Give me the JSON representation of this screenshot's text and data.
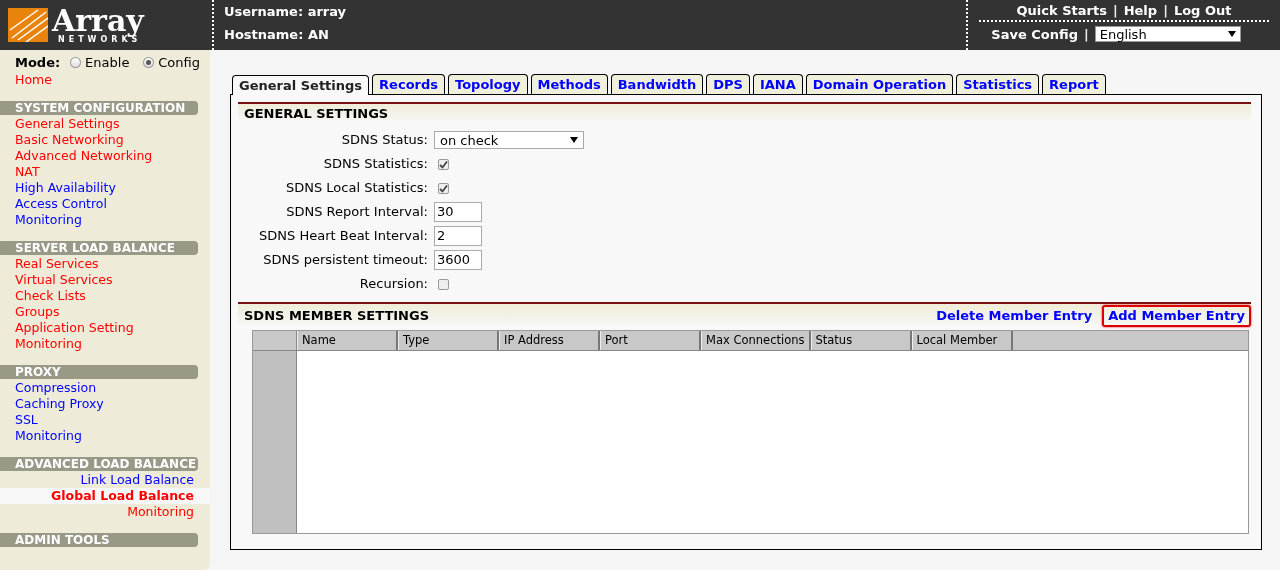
{
  "header": {
    "logo": {
      "word": "Array",
      "sub": "NETWORKS"
    },
    "username": "Username: array",
    "hostname": "Hostname: AN",
    "top_links": [
      {
        "kind": "link",
        "label": "Quick Starts"
      },
      {
        "kind": "separator",
        "label": "|"
      },
      {
        "kind": "link",
        "label": "Help"
      },
      {
        "kind": "separator",
        "label": "|"
      },
      {
        "kind": "link",
        "label": "Log Out"
      }
    ],
    "save_links": [
      {
        "kind": "link",
        "label": "Save Config"
      },
      {
        "kind": "separator",
        "label": "|"
      }
    ],
    "language": {
      "value": "English"
    }
  },
  "sidebar": {
    "mode_label": "Mode:",
    "modes": [
      {
        "label": "Enable",
        "selected": false
      },
      {
        "label": "Config",
        "selected": true
      }
    ],
    "home": {
      "label": "Home",
      "color": "#ff0000"
    },
    "sections": [
      {
        "title": "SYSTEM CONFIGURATION",
        "kind": "left",
        "items": [
          {
            "label": "General Settings",
            "color": "#ff0000",
            "selected": false
          },
          {
            "label": "Basic Networking",
            "color": "#ff0000",
            "selected": false
          },
          {
            "label": "Advanced Networking",
            "color": "#ff0000",
            "selected": false
          },
          {
            "label": "NAT",
            "color": "#ff0000",
            "selected": false
          },
          {
            "label": "High Availability",
            "color": "#0000ff",
            "selected": false
          },
          {
            "label": "Access Control",
            "color": "#0000ff",
            "selected": false
          },
          {
            "label": "Monitoring",
            "color": "#0000ff",
            "selected": false
          }
        ]
      },
      {
        "title": "SERVER LOAD BALANCE",
        "kind": "left",
        "items": [
          {
            "label": "Real Services",
            "color": "#ff0000",
            "selected": false
          },
          {
            "label": "Virtual Services",
            "color": "#ff0000",
            "selected": false
          },
          {
            "label": "Check Lists",
            "color": "#ff0000",
            "selected": false
          },
          {
            "label": "Groups",
            "color": "#ff0000",
            "selected": false
          },
          {
            "label": "Application Setting",
            "color": "#ff0000",
            "selected": false
          },
          {
            "label": "Monitoring",
            "color": "#ff0000",
            "selected": false
          }
        ]
      },
      {
        "title": "PROXY",
        "kind": "left",
        "items": [
          {
            "label": "Compression",
            "color": "#0000ff",
            "selected": false
          },
          {
            "label": "Caching Proxy",
            "color": "#0000ff",
            "selected": false
          },
          {
            "label": "SSL",
            "color": "#0000ff",
            "selected": false
          },
          {
            "label": "Monitoring",
            "color": "#0000ff",
            "selected": false
          }
        ]
      },
      {
        "title": "ADVANCED LOAD BALANCE",
        "kind": "right",
        "items": [
          {
            "label": "Link Load Balance",
            "color": "#0000ff",
            "selected": false
          },
          {
            "label": "Global Load Balance",
            "color": "#ff0000",
            "selected": true
          },
          {
            "label": "Monitoring",
            "color": "#ff0000",
            "selected": false
          }
        ]
      },
      {
        "title": "ADMIN TOOLS",
        "kind": "left"
      }
    ]
  },
  "tabs": [
    {
      "label": "General Settings",
      "selected": true
    },
    {
      "label": "Records",
      "selected": false
    },
    {
      "label": "Topology",
      "selected": false
    },
    {
      "label": "Methods",
      "selected": false
    },
    {
      "label": "Bandwidth",
      "selected": false
    },
    {
      "label": "DPS",
      "selected": false
    },
    {
      "label": "IANA",
      "selected": false
    },
    {
      "label": "Domain Operation",
      "selected": false
    },
    {
      "label": "Statistics",
      "selected": false
    },
    {
      "label": "Report",
      "selected": false
    }
  ],
  "general_settings": {
    "title": "GENERAL SETTINGS",
    "fields": [
      {
        "kind": "select",
        "label": "SDNS Status:",
        "value": "on check"
      },
      {
        "kind": "checkbox",
        "label": "SDNS Statistics:",
        "checked": true
      },
      {
        "kind": "checkbox",
        "label": "SDNS Local Statistics:",
        "checked": true
      },
      {
        "kind": "text",
        "label": "SDNS Report Interval:",
        "value": "30"
      },
      {
        "kind": "text",
        "label": "SDNS Heart Beat Interval:",
        "value": "2"
      },
      {
        "kind": "text",
        "label": "SDNS persistent timeout:",
        "value": "3600"
      },
      {
        "kind": "checkbox",
        "label": "Recursion:",
        "checked": false
      }
    ]
  },
  "member_settings": {
    "title": "SDNS MEMBER SETTINGS",
    "actions": [
      {
        "label": "Delete Member Entry",
        "highlighted": false
      },
      {
        "label": "Add Member Entry",
        "highlighted": true
      }
    ],
    "table": {
      "columns": [
        "Name",
        "Type",
        "IP Address",
        "Port",
        "Max Connections",
        "Status",
        "Local Member"
      ]
    }
  }
}
